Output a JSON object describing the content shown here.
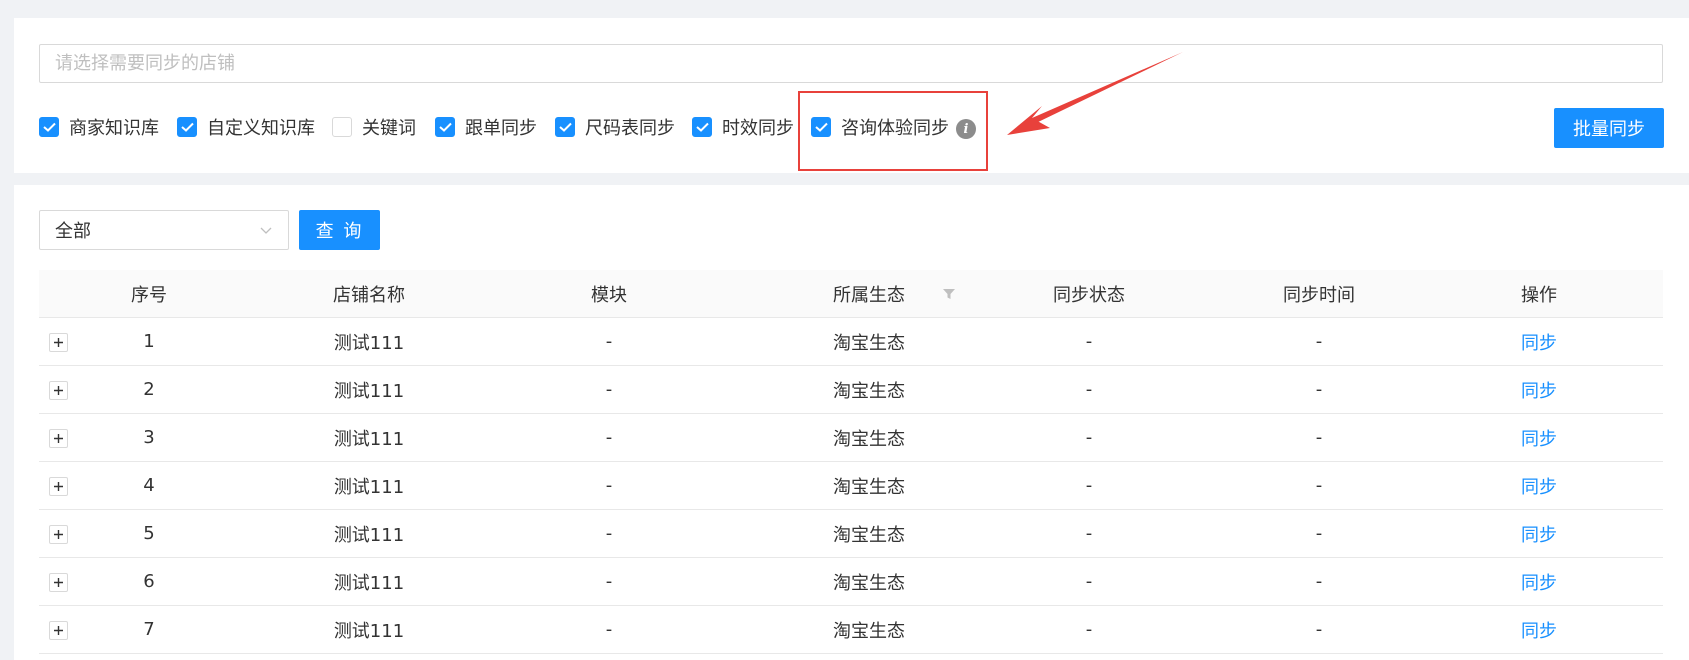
{
  "search": {
    "placeholder": "请选择需要同步的店铺"
  },
  "sync_options": [
    {
      "label": "商家知识库",
      "checked": true
    },
    {
      "label": "自定义知识库",
      "checked": true
    },
    {
      "label": "关键词",
      "checked": false
    },
    {
      "label": "跟单同步",
      "checked": true
    },
    {
      "label": "尺码表同步",
      "checked": true
    },
    {
      "label": "时效同步",
      "checked": true
    },
    {
      "label": "咨询体验同步",
      "checked": true
    }
  ],
  "info_icon_glyph": "i",
  "batch_sync_label": "批量同步",
  "filter": {
    "selected": "全部"
  },
  "query_label": "查 询",
  "table": {
    "columns": [
      "序号",
      "店铺名称",
      "模块",
      "所属生态",
      "同步状态",
      "同步时间",
      "操作"
    ],
    "rows": [
      {
        "seq": "1",
        "shop": "测试111",
        "module": "-",
        "eco": "淘宝生态",
        "status": "-",
        "time": "-",
        "op": "同步"
      },
      {
        "seq": "2",
        "shop": "测试111",
        "module": "-",
        "eco": "淘宝生态",
        "status": "-",
        "time": "-",
        "op": "同步"
      },
      {
        "seq": "3",
        "shop": "测试111",
        "module": "-",
        "eco": "淘宝生态",
        "status": "-",
        "time": "-",
        "op": "同步"
      },
      {
        "seq": "4",
        "shop": "测试111",
        "module": "-",
        "eco": "淘宝生态",
        "status": "-",
        "time": "-",
        "op": "同步"
      },
      {
        "seq": "5",
        "shop": "测试111",
        "module": "-",
        "eco": "淘宝生态",
        "status": "-",
        "time": "-",
        "op": "同步"
      },
      {
        "seq": "6",
        "shop": "测试111",
        "module": "-",
        "eco": "淘宝生态",
        "status": "-",
        "time": "-",
        "op": "同步"
      },
      {
        "seq": "7",
        "shop": "测试111",
        "module": "-",
        "eco": "淘宝生态",
        "status": "-",
        "time": "-",
        "op": "同步"
      }
    ]
  },
  "colors": {
    "primary": "#1890ff",
    "annotation": "#e8413b"
  }
}
